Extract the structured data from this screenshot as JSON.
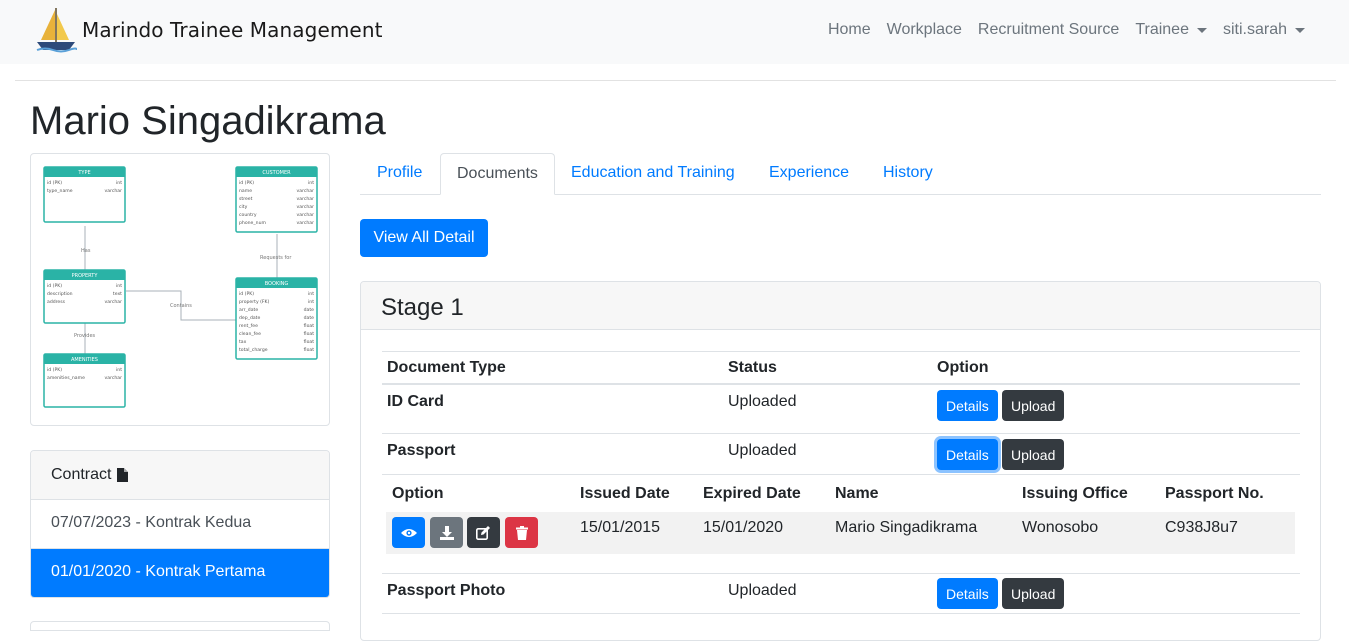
{
  "navbar": {
    "brand": "Marindo Trainee Management",
    "links": [
      "Home",
      "Workplace",
      "Recruitment Source",
      "Trainee",
      "siti.sarah"
    ]
  },
  "page": {
    "title": "Mario Singadikrama"
  },
  "erd": {
    "tables": [
      {
        "name": "TYPE",
        "rows": [
          [
            "id (PK)",
            "int"
          ],
          [
            "type_name",
            "varchar"
          ]
        ]
      },
      {
        "name": "CUSTOMER",
        "rows": [
          [
            "id (PK)",
            "int"
          ],
          [
            "name",
            "varchar"
          ],
          [
            "street",
            "varchar"
          ],
          [
            "city",
            "varchar"
          ],
          [
            "country",
            "varchar"
          ],
          [
            "phone_num",
            "varchar"
          ]
        ]
      },
      {
        "name": "PROPERTY",
        "rows": [
          [
            "id (PK)",
            "int"
          ],
          [
            "description",
            "text"
          ],
          [
            "address",
            "varchar"
          ]
        ]
      },
      {
        "name": "BOOKING",
        "rows": [
          [
            "id (PK)",
            "int"
          ],
          [
            "property (FK)",
            "int"
          ],
          [
            "arr_date",
            "date"
          ],
          [
            "dep_date",
            "date"
          ],
          [
            "rent_fee",
            "float"
          ],
          [
            "clean_fee",
            "float"
          ],
          [
            "tax",
            "float"
          ],
          [
            "total_charge",
            "float"
          ]
        ]
      },
      {
        "name": "AMENITIES",
        "rows": [
          [
            "id (PK)",
            "int"
          ],
          [
            "amenities_name",
            "varchar"
          ]
        ]
      }
    ],
    "relations": [
      "Has",
      "Requests for",
      "Contains",
      "Provides"
    ]
  },
  "contract": {
    "title": "Contract",
    "items": [
      "07/07/2023 - Kontrak Kedua",
      "01/01/2020 - Kontrak Pertama"
    ],
    "active_index": 1
  },
  "tabs": [
    "Profile",
    "Documents",
    "Education and Training",
    "Experience",
    "History"
  ],
  "active_tab": "Documents",
  "view_all_label": "View All Detail",
  "stage": {
    "title": "Stage 1",
    "headers": [
      "Document Type",
      "Status",
      "Option"
    ],
    "docs": [
      {
        "type": "ID Card",
        "status": "Uploaded",
        "details": "Details",
        "upload": "Upload"
      },
      {
        "type": "Passport",
        "status": "Uploaded",
        "details": "Details",
        "upload": "Upload"
      },
      {
        "type": "Passport Photo",
        "status": "Uploaded",
        "details": "Details",
        "upload": "Upload"
      }
    ],
    "passport_detail": {
      "headers": [
        "Option",
        "Issued Date",
        "Expired Date",
        "Name",
        "Issuing Office",
        "Passport No."
      ],
      "row": {
        "issued": "15/01/2015",
        "expired": "15/01/2020",
        "name": "Mario Singadikrama",
        "office": "Wonosobo",
        "number": "C938J8u7"
      }
    }
  },
  "colors": {
    "primary": "#007bff",
    "dark": "#343a40",
    "secondary": "#6c757d",
    "danger": "#dc3545",
    "erd_teal": "#2ab3a6"
  }
}
